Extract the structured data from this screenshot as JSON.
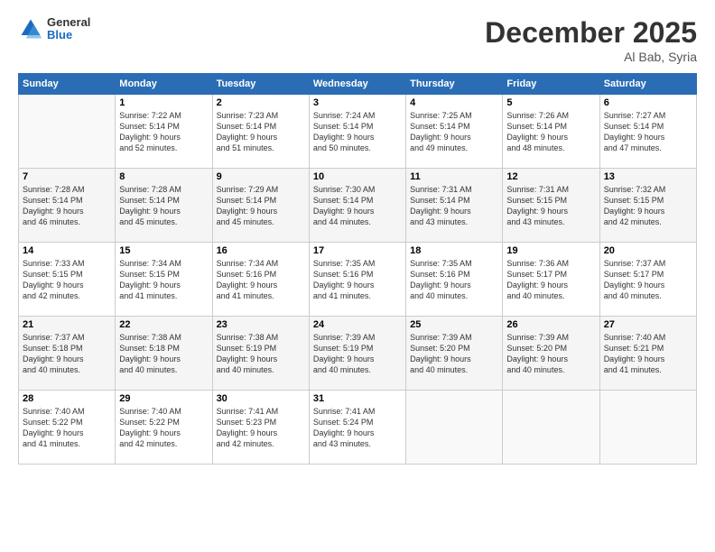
{
  "header": {
    "logo": {
      "general": "General",
      "blue": "Blue"
    },
    "title": "December 2025",
    "subtitle": "Al Bab, Syria"
  },
  "weekdays": [
    "Sunday",
    "Monday",
    "Tuesday",
    "Wednesday",
    "Thursday",
    "Friday",
    "Saturday"
  ],
  "weeks": [
    [
      {
        "num": "",
        "info": ""
      },
      {
        "num": "1",
        "info": "Sunrise: 7:22 AM\nSunset: 5:14 PM\nDaylight: 9 hours\nand 52 minutes."
      },
      {
        "num": "2",
        "info": "Sunrise: 7:23 AM\nSunset: 5:14 PM\nDaylight: 9 hours\nand 51 minutes."
      },
      {
        "num": "3",
        "info": "Sunrise: 7:24 AM\nSunset: 5:14 PM\nDaylight: 9 hours\nand 50 minutes."
      },
      {
        "num": "4",
        "info": "Sunrise: 7:25 AM\nSunset: 5:14 PM\nDaylight: 9 hours\nand 49 minutes."
      },
      {
        "num": "5",
        "info": "Sunrise: 7:26 AM\nSunset: 5:14 PM\nDaylight: 9 hours\nand 48 minutes."
      },
      {
        "num": "6",
        "info": "Sunrise: 7:27 AM\nSunset: 5:14 PM\nDaylight: 9 hours\nand 47 minutes."
      }
    ],
    [
      {
        "num": "7",
        "info": "Sunrise: 7:28 AM\nSunset: 5:14 PM\nDaylight: 9 hours\nand 46 minutes."
      },
      {
        "num": "8",
        "info": "Sunrise: 7:28 AM\nSunset: 5:14 PM\nDaylight: 9 hours\nand 45 minutes."
      },
      {
        "num": "9",
        "info": "Sunrise: 7:29 AM\nSunset: 5:14 PM\nDaylight: 9 hours\nand 45 minutes."
      },
      {
        "num": "10",
        "info": "Sunrise: 7:30 AM\nSunset: 5:14 PM\nDaylight: 9 hours\nand 44 minutes."
      },
      {
        "num": "11",
        "info": "Sunrise: 7:31 AM\nSunset: 5:14 PM\nDaylight: 9 hours\nand 43 minutes."
      },
      {
        "num": "12",
        "info": "Sunrise: 7:31 AM\nSunset: 5:15 PM\nDaylight: 9 hours\nand 43 minutes."
      },
      {
        "num": "13",
        "info": "Sunrise: 7:32 AM\nSunset: 5:15 PM\nDaylight: 9 hours\nand 42 minutes."
      }
    ],
    [
      {
        "num": "14",
        "info": "Sunrise: 7:33 AM\nSunset: 5:15 PM\nDaylight: 9 hours\nand 42 minutes."
      },
      {
        "num": "15",
        "info": "Sunrise: 7:34 AM\nSunset: 5:15 PM\nDaylight: 9 hours\nand 41 minutes."
      },
      {
        "num": "16",
        "info": "Sunrise: 7:34 AM\nSunset: 5:16 PM\nDaylight: 9 hours\nand 41 minutes."
      },
      {
        "num": "17",
        "info": "Sunrise: 7:35 AM\nSunset: 5:16 PM\nDaylight: 9 hours\nand 41 minutes."
      },
      {
        "num": "18",
        "info": "Sunrise: 7:35 AM\nSunset: 5:16 PM\nDaylight: 9 hours\nand 40 minutes."
      },
      {
        "num": "19",
        "info": "Sunrise: 7:36 AM\nSunset: 5:17 PM\nDaylight: 9 hours\nand 40 minutes."
      },
      {
        "num": "20",
        "info": "Sunrise: 7:37 AM\nSunset: 5:17 PM\nDaylight: 9 hours\nand 40 minutes."
      }
    ],
    [
      {
        "num": "21",
        "info": "Sunrise: 7:37 AM\nSunset: 5:18 PM\nDaylight: 9 hours\nand 40 minutes."
      },
      {
        "num": "22",
        "info": "Sunrise: 7:38 AM\nSunset: 5:18 PM\nDaylight: 9 hours\nand 40 minutes."
      },
      {
        "num": "23",
        "info": "Sunrise: 7:38 AM\nSunset: 5:19 PM\nDaylight: 9 hours\nand 40 minutes."
      },
      {
        "num": "24",
        "info": "Sunrise: 7:39 AM\nSunset: 5:19 PM\nDaylight: 9 hours\nand 40 minutes."
      },
      {
        "num": "25",
        "info": "Sunrise: 7:39 AM\nSunset: 5:20 PM\nDaylight: 9 hours\nand 40 minutes."
      },
      {
        "num": "26",
        "info": "Sunrise: 7:39 AM\nSunset: 5:20 PM\nDaylight: 9 hours\nand 40 minutes."
      },
      {
        "num": "27",
        "info": "Sunrise: 7:40 AM\nSunset: 5:21 PM\nDaylight: 9 hours\nand 41 minutes."
      }
    ],
    [
      {
        "num": "28",
        "info": "Sunrise: 7:40 AM\nSunset: 5:22 PM\nDaylight: 9 hours\nand 41 minutes."
      },
      {
        "num": "29",
        "info": "Sunrise: 7:40 AM\nSunset: 5:22 PM\nDaylight: 9 hours\nand 42 minutes."
      },
      {
        "num": "30",
        "info": "Sunrise: 7:41 AM\nSunset: 5:23 PM\nDaylight: 9 hours\nand 42 minutes."
      },
      {
        "num": "31",
        "info": "Sunrise: 7:41 AM\nSunset: 5:24 PM\nDaylight: 9 hours\nand 43 minutes."
      },
      {
        "num": "",
        "info": ""
      },
      {
        "num": "",
        "info": ""
      },
      {
        "num": "",
        "info": ""
      }
    ]
  ]
}
